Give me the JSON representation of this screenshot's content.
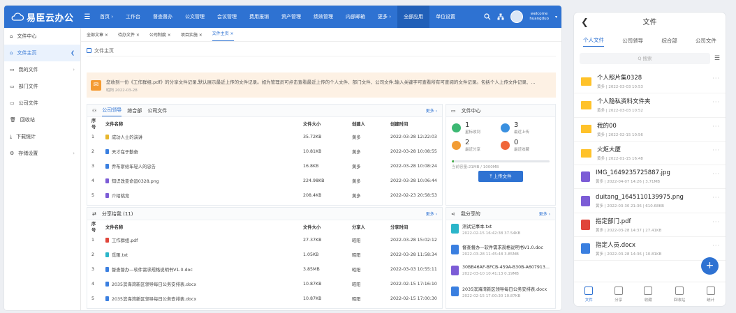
{
  "app": {
    "title": "易臣云办公",
    "menu_icon": "☰"
  },
  "nav": [
    "首页 ›",
    "工作台",
    "督查督办",
    "公文管理",
    "会议管理",
    "费用报销",
    "资产管理",
    "绩效管理",
    "内部邮箱",
    "更多 ›",
    "全部应用",
    "单位设置"
  ],
  "user": {
    "welcome": "welcome",
    "name": "huangduo"
  },
  "sidebar": [
    {
      "label": "文件中心",
      "icon": "home-icon"
    },
    {
      "label": "文件主页",
      "icon": "home-icon",
      "arrow": "❮"
    },
    {
      "label": "我的文件",
      "icon": "folder-icon",
      "arrow": "›"
    },
    {
      "label": "部门文件",
      "icon": "folder-icon"
    },
    {
      "label": "公司文件",
      "icon": "folder-icon"
    },
    {
      "label": "回收站",
      "icon": "trash-icon"
    },
    {
      "label": "下载统计",
      "icon": "download-icon"
    },
    {
      "label": "存储设置",
      "icon": "settings-icon",
      "arrow": "›"
    }
  ],
  "tabs": [
    "全部文章 ×",
    "待办文件 ×",
    "公司制度 ×",
    "项目实施 ×",
    "文件主页 ×"
  ],
  "breadcrumb": "文件主页",
  "notice": {
    "text": "您收到一份《工作群组.pdf》的分享文件记录,默认展示最近上传的文件记录。如为管理员可点击查看最近上传的个人文件、部门文件、公司文件;输入关键字可查看所有可查阅的文件记录。包括个人上传文件记录、...",
    "date": "昭阳 2022-03-28"
  },
  "files_panel": {
    "tabs": [
      "公司领导",
      "综合部",
      "公司文件"
    ],
    "more": "更多 ›",
    "columns": [
      "序号",
      "文件名称",
      "文件大小",
      "创建人",
      "创建时间"
    ],
    "rows": [
      {
        "no": "1",
        "name": "成功人士的演讲",
        "size": "35.72KB",
        "creator": "黄多",
        "time": "2022-03-28 12:22:03",
        "color": "#e7b62d"
      },
      {
        "no": "2",
        "name": "天才在于勤奋",
        "size": "10.81KB",
        "creator": "黄多",
        "time": "2022-03-28 10:08:55",
        "color": "#3a7fe0"
      },
      {
        "no": "3",
        "name": "乔布斯给年轻人的忠告",
        "size": "16.8KB",
        "creator": "黄多",
        "time": "2022-03-28 10:08:24",
        "color": "#3a7fe0"
      },
      {
        "no": "4",
        "name": "知识改变命运0328.png",
        "size": "224.98KB",
        "creator": "黄多",
        "time": "2022-03-28 10:06:44",
        "color": "#7c5cd6"
      },
      {
        "no": "5",
        "name": "介绍桃竞",
        "size": "208.4KB",
        "creator": "黄多",
        "time": "2022-02-23 20:58:53",
        "color": "#7c5cd6"
      }
    ]
  },
  "shared_panel": {
    "title": "分享给我 (11)",
    "more": "更多 ›",
    "columns": [
      "序号",
      "文件名称",
      "文件大小",
      "分享人",
      "分享时间"
    ],
    "rows": [
      {
        "no": "1",
        "name": "工作群组.pdf",
        "size": "27.37KB",
        "sharer": "昭阳",
        "time": "2022-03-28 15:02:12",
        "color": "#e0453a"
      },
      {
        "no": "2",
        "name": "觅匯.txt",
        "size": "1.05KB",
        "sharer": "昭阳",
        "time": "2022-03-28 11:58:34",
        "color": "#2bb5c9"
      },
      {
        "no": "3",
        "name": "督查督办—软件需求规格说明书V1.0.doc",
        "size": "3.85MB",
        "sharer": "昭阳",
        "time": "2022-03-03 10:55:11",
        "color": "#3a7fe0"
      },
      {
        "no": "4",
        "name": "2035滨海湾新区领导每日公务安排表.docx",
        "size": "10.87KB",
        "sharer": "昭阳",
        "time": "2022-02-15 17:16:10",
        "color": "#3a7fe0"
      },
      {
        "no": "5",
        "name": "2035滨海湾新区领导每日公务安排表.docx",
        "size": "10.87KB",
        "sharer": "昭阳",
        "time": "2022-02-15 17:00:30",
        "color": "#3a7fe0"
      }
    ]
  },
  "file_center": {
    "title": "文件中心",
    "stats": [
      {
        "num": "1",
        "label": "星标收到",
        "color": "#3cb873"
      },
      {
        "num": "3",
        "label": "最近上传",
        "color": "#3a90e0"
      },
      {
        "num": "2",
        "label": "最近分享",
        "color": "#f29c33"
      },
      {
        "num": "0",
        "label": "最近收藏",
        "color": "#f0673a"
      }
    ],
    "storage": "当前容量:21MB / 1000MB",
    "storage_fraction": 0.021,
    "upload": "⤒ 上传文件"
  },
  "my_shares": {
    "title": "我分享的",
    "more": "更多 ›",
    "items": [
      {
        "name": "测试记事本.txt",
        "meta": "2022-02-15 16:42:38   37.54KB",
        "color": "#2bb5c9"
      },
      {
        "name": "督查督办—软件需求规格说明书V1.0.doc",
        "meta": "2022-03-28 11:45:48   3.85MB",
        "color": "#3a7fe0"
      },
      {
        "name": "30BB46AF-BFCB-459A-B30B-A607913...",
        "meta": "2022-03-10 10:41:13   0.19MB",
        "color": "#7c5cd6"
      },
      {
        "name": "2035滨海湾新区领导每日公务安排表.docx",
        "meta": "2022-02-15 17:00:30   10.87KB",
        "color": "#3a7fe0"
      }
    ]
  },
  "mobile": {
    "title": "文件",
    "back": "❮",
    "tabs": [
      "个人文件",
      "公司领导",
      "综合部",
      "公司文件"
    ],
    "search_placeholder": "Q 搜索",
    "list_icon": "☰",
    "items": [
      {
        "name": "个人照片集0328",
        "meta": "黄多 | 2022-03-03 10:53",
        "type": "folder"
      },
      {
        "name": "个人隐私资料文件夹",
        "meta": "黄多 | 2022-03-03 10:52",
        "type": "folder"
      },
      {
        "name": "我的00",
        "meta": "黄多 | 2022-02-15 10:56",
        "type": "folder"
      },
      {
        "name": "火炬大厦",
        "meta": "黄多 | 2022-01-15 16:48",
        "type": "folder"
      },
      {
        "name": "IMG_1649235725887.jpg",
        "meta": "黄多 | 2022-04-07 14:26 | 3.71MB",
        "type": "image",
        "color": "#7c5cd6"
      },
      {
        "name": "duitang_1645110139975.png",
        "meta": "黄多 | 2022-03-30 21:36 | 610.68KB",
        "type": "image",
        "color": "#7c5cd6"
      },
      {
        "name": "指定部门.pdf",
        "meta": "黄多 | 2022-03-28 14:37 | 27.41KB",
        "type": "pdf",
        "color": "#e0453a"
      },
      {
        "name": "指定人员.docx",
        "meta": "黄多 | 2022-03-28 14:36 | 10.81KB",
        "type": "doc",
        "color": "#3a7fe0"
      }
    ],
    "fab": "+",
    "bottom": [
      "文件",
      "分享",
      "收藏",
      "回收站",
      "统计"
    ]
  }
}
